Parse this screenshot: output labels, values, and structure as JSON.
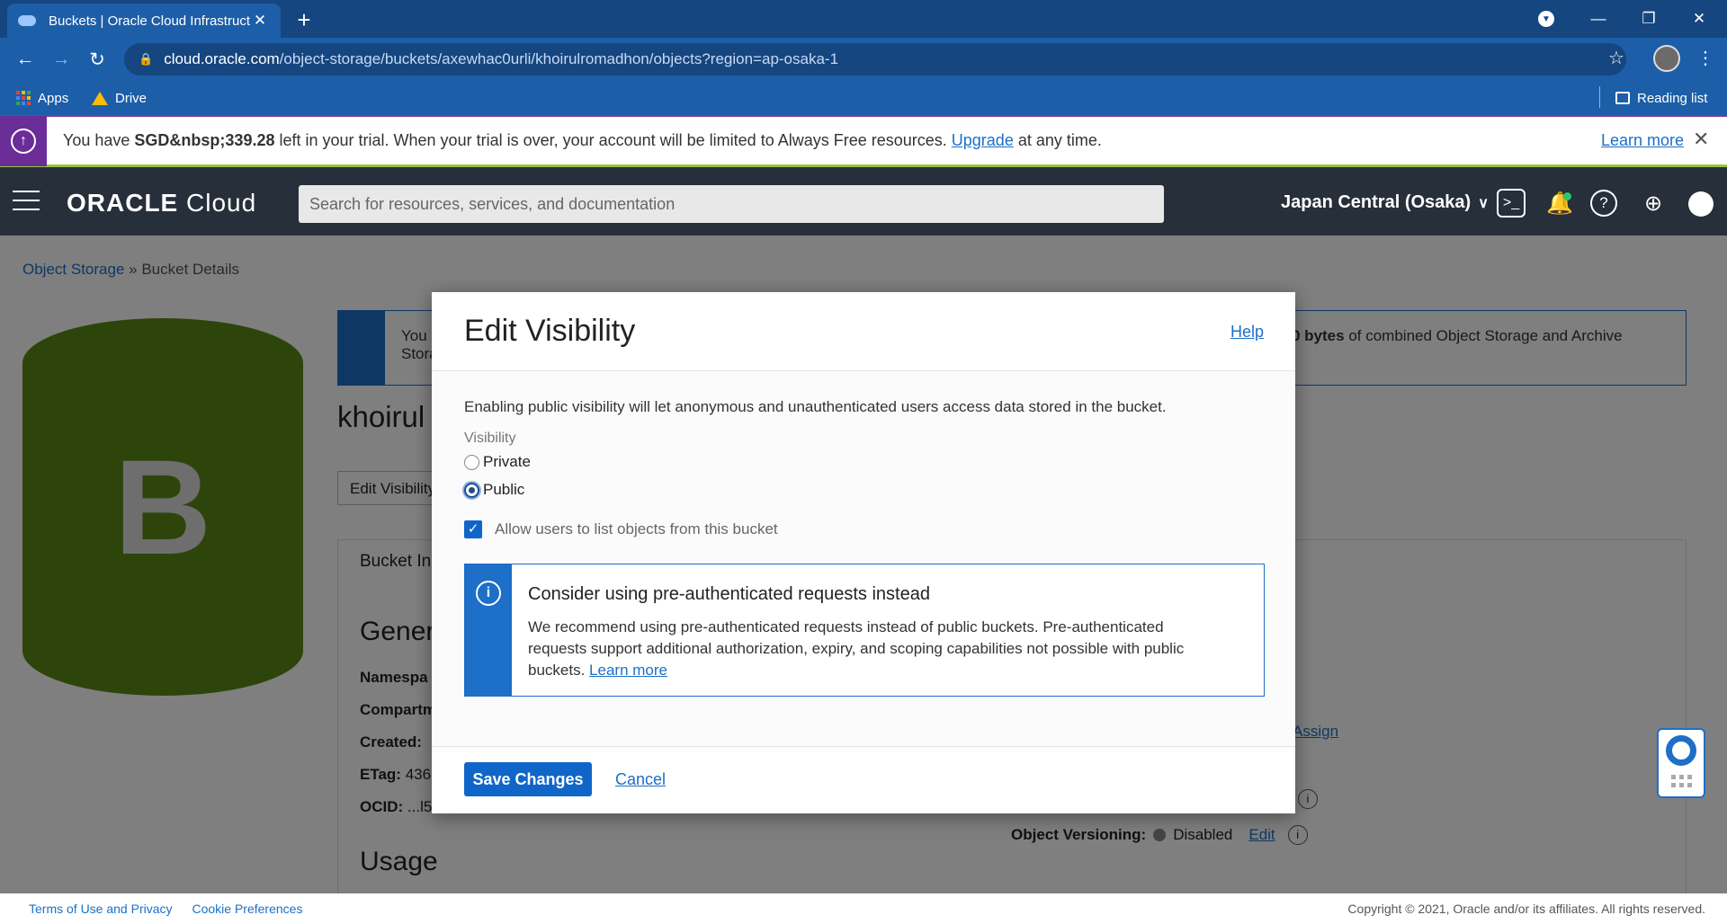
{
  "browser": {
    "tab_title": "Buckets | Oracle Cloud Infrastruct",
    "tab_close": "✕",
    "new_tab": "+",
    "url_host": "cloud.oracle.com",
    "url_path": "/object-storage/buckets/axewhac0urli/khoirulromadhon/objects?region=ap-osaka-1",
    "bookmarks": {
      "apps": "Apps",
      "drive": "Drive",
      "reading_list": "Reading list"
    }
  },
  "trial_banner": {
    "text_before": "You have ",
    "amount": "SGD&nbsp;339.28",
    "text_middle": " left in your trial. When your trial is over, your account will be limited to Always Free resources. ",
    "upgrade": "Upgrade",
    "text_after": " at any time.",
    "learn_more": "Learn more"
  },
  "header": {
    "logo_oracle": "ORACLE",
    "logo_cloud": "Cloud",
    "search_placeholder": "Search for resources, services, and documentation",
    "region": "Japan Central (Osaka)"
  },
  "page": {
    "breadcrumb_link": "Object Storage",
    "breadcrumb_sep": "»",
    "breadcrumb_current": "Bucket Details",
    "bucket_letter": "B",
    "bucket_color": "#5b8a17",
    "info_left_1": "You",
    "info_left_2": "Stora",
    "info_right_bold": "0 bytes",
    "info_right": " of combined Object Storage and Archive",
    "bucket_name": "khoirul",
    "edit_visibility": "Edit Visibility",
    "tab_bucket_info": "Bucket In",
    "general": "Gener",
    "namespace": "Namespa",
    "compartment": "Compartm",
    "created": "Created: ",
    "etag": "ETag:",
    "etag_value": "436",
    "ocid": "OCID:",
    "ocid_value": "...l5",
    "assign": "Assign",
    "object_versioning_label": "Object Versioning:",
    "object_versioning_value": "Disabled",
    "edit": "Edit",
    "usage": "Usage"
  },
  "modal": {
    "title": "Edit Visibility",
    "help": "Help",
    "description": "Enabling public visibility will let anonymous and unauthenticated users access data stored in the bucket.",
    "visibility_label": "Visibility",
    "option_private": "Private",
    "option_public": "Public",
    "selected": "Public",
    "allow_list_label": "Allow users to list objects from this bucket",
    "allow_list_checked": true,
    "info_title": "Consider using pre-authenticated requests instead",
    "info_text_1": "We recommend using pre-authenticated requests instead of public buckets. Pre-authenticated",
    "info_text_2": "requests support additional authorization, expiry, and scoping capabilities not possible with public",
    "info_text_3": "buckets. ",
    "info_learn_more": "Learn more",
    "save": "Save Changes",
    "cancel": "Cancel"
  },
  "footer": {
    "terms": "Terms of Use and Privacy",
    "cookies": "Cookie Preferences",
    "copyright": "Copyright © 2021, Oracle and/or its affiliates. All rights reserved."
  }
}
